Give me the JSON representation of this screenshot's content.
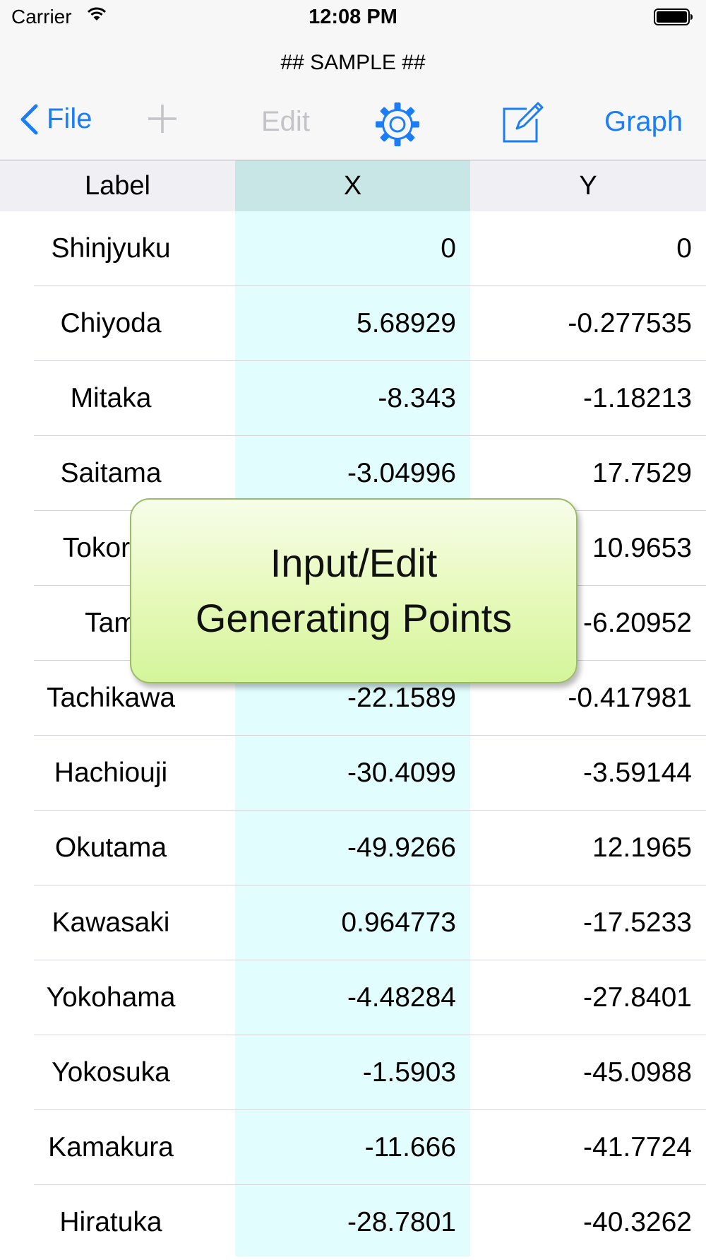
{
  "status_bar": {
    "carrier": "Carrier",
    "time": "12:08 PM"
  },
  "nav": {
    "title": "## SAMPLE ##",
    "back_label": "File",
    "edit_label": "Edit",
    "graph_label": "Graph",
    "accent_color": "#1b7ef8"
  },
  "table": {
    "headers": [
      "Label",
      "X",
      "Y"
    ],
    "rows": [
      {
        "label": "Shinjyuku",
        "x": "0",
        "y": "0"
      },
      {
        "label": "Chiyoda",
        "x": "5.68929",
        "y": "-0.277535"
      },
      {
        "label": "Mitaka",
        "x": "-8.343",
        "y": "-1.18213"
      },
      {
        "label": "Saitama",
        "x": "-3.04996",
        "y": "17.7529"
      },
      {
        "label": "Tokoraz",
        "x": "",
        "y": "10.9653"
      },
      {
        "label": "Tam",
        "x": "",
        "y": "-6.20952"
      },
      {
        "label": "Tachikawa",
        "x": "-22.1589",
        "y": "-0.417981"
      },
      {
        "label": "Hachiouji",
        "x": "-30.4099",
        "y": "-3.59144"
      },
      {
        "label": "Okutama",
        "x": "-49.9266",
        "y": "12.1965"
      },
      {
        "label": "Kawasaki",
        "x": "0.964773",
        "y": "-17.5233"
      },
      {
        "label": "Yokohama",
        "x": "-4.48284",
        "y": "-27.8401"
      },
      {
        "label": "Yokosuka",
        "x": "-1.5903",
        "y": "-45.0988"
      },
      {
        "label": "Kamakura",
        "x": "-11.666",
        "y": "-41.7724"
      },
      {
        "label": "Hiratuka",
        "x": "-28.7801",
        "y": "-40.3262"
      }
    ]
  },
  "callout": {
    "line1": "Input/Edit",
    "line2": "Generating Points"
  },
  "icons": [
    "wifi-icon",
    "battery-icon",
    "chevron-left-icon",
    "plus-icon",
    "gear-icon",
    "compose-icon"
  ]
}
